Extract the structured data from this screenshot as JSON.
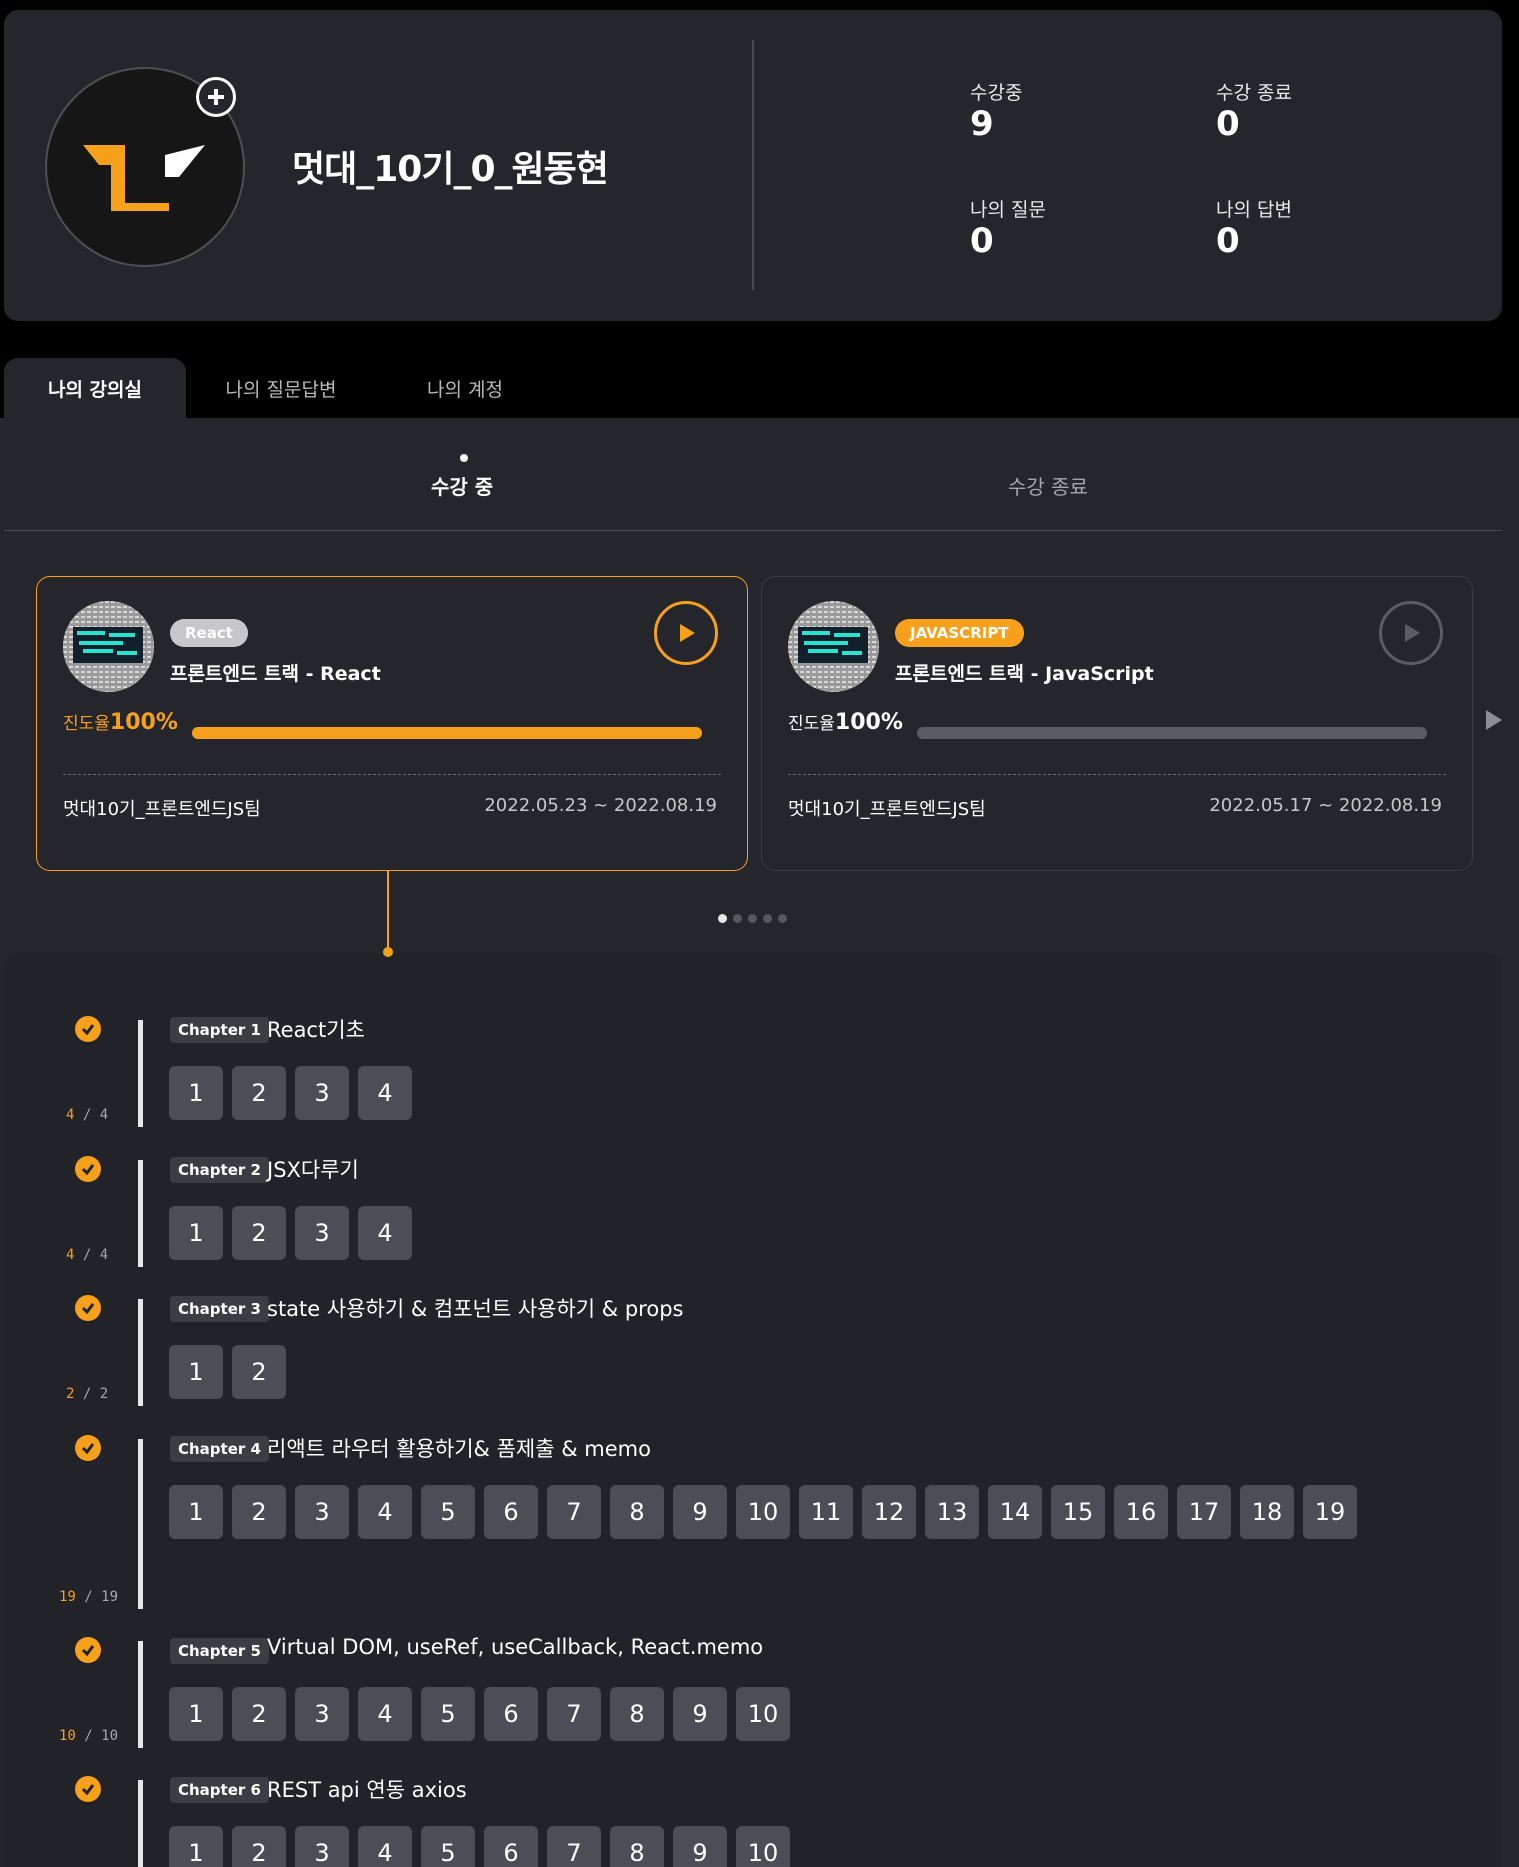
{
  "profile": {
    "name": "멋대_10기_0_원동현",
    "stats": [
      {
        "label": "수강중",
        "value": "9"
      },
      {
        "label": "수강 종료",
        "value": "0"
      },
      {
        "label": "나의 질문",
        "value": "0"
      },
      {
        "label": "나의 답변",
        "value": "0"
      }
    ]
  },
  "tabs": [
    "나의 강의실",
    "나의 질문답변",
    "나의 계정"
  ],
  "subtabs": [
    "수강 중",
    "수강 종료"
  ],
  "courses": [
    {
      "badge": "React",
      "title": "프론트엔드 트랙 - React",
      "progress_label": "진도율",
      "progress_value": "100%",
      "progress": 1.0,
      "team": "멋대10기_프론트엔드JS팀",
      "period": "2022.05.23 ~ 2022.08.19"
    },
    {
      "badge": "JAVASCRIPT",
      "title": "프론트엔드 트랙 - JavaScript",
      "progress_label": "진도율",
      "progress_value": "100%",
      "progress": 1.0,
      "team": "멋대10기_프론트엔드JS팀",
      "period": "2022.05.17 ~ 2022.08.19"
    }
  ],
  "colors": {
    "accent": "#f7a01c",
    "panel": "#25262c",
    "lesson": "#4c4d55"
  },
  "chapters": [
    {
      "tag": "Chapter 1",
      "title": "React기초",
      "done": "4",
      "total": "4",
      "lessons": [
        "1",
        "2",
        "3",
        "4"
      ]
    },
    {
      "tag": "Chapter 2",
      "title": "JSX다루기",
      "done": "4",
      "total": "4",
      "lessons": [
        "1",
        "2",
        "3",
        "4"
      ]
    },
    {
      "tag": "Chapter 3",
      "title": "state 사용하기 & 컴포넌트 사용하기 & props",
      "done": "2",
      "total": "2",
      "lessons": [
        "1",
        "2"
      ]
    },
    {
      "tag": "Chapter 4",
      "title": "리액트 라우터 활용하기& 폼제출 & memo",
      "done": "19",
      "total": "19",
      "lessons": [
        "1",
        "2",
        "3",
        "4",
        "5",
        "6",
        "7",
        "8",
        "9",
        "10",
        "11",
        "12",
        "13",
        "14",
        "15",
        "16",
        "17",
        "18",
        "19"
      ]
    },
    {
      "tag": "Chapter 5",
      "title": "Virtual DOM, useRef, useCallback, React.memo",
      "done": "10",
      "total": "10",
      "lessons": [
        "1",
        "2",
        "3",
        "4",
        "5",
        "6",
        "7",
        "8",
        "9",
        "10"
      ]
    },
    {
      "tag": "Chapter 6",
      "title": "REST api 연동 axios",
      "done": "",
      "total": "",
      "lessons": [
        "1",
        "2",
        "3",
        "4",
        "5",
        "6",
        "7",
        "8",
        "9",
        "10"
      ]
    }
  ]
}
